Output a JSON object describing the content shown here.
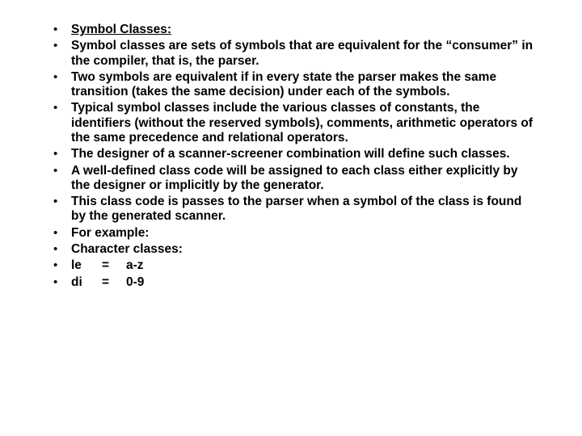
{
  "bullets": {
    "b0": "Symbol Classes:",
    "b1": "Symbol classes are sets of symbols that are equivalent for the “consumer” in the compiler, that is, the parser.",
    "b2": "Two symbols are equivalent if in every state the parser makes the same transition (takes the same decision) under each of the symbols.",
    "b3": "Typical symbol classes include the various classes of constants, the identifiers (without the reserved symbols), comments, arithmetic operators of the same precedence and relational operators.",
    "b4": "The designer of a scanner-screener combination will define such classes.",
    "b5": "A well-defined class code will be assigned to each class either explicitly by the designer or implicitly by the generator.",
    "b6": "This class code is passes to the parser when a symbol of the class is found by the generated scanner.",
    "b7": "For example:",
    "b8": "Character classes:",
    "b9": {
      "c1": "le",
      "c2": "=",
      "c3": "a-z"
    },
    "b10": {
      "c1": "di",
      "c2": "=",
      "c3": "0-9"
    }
  }
}
